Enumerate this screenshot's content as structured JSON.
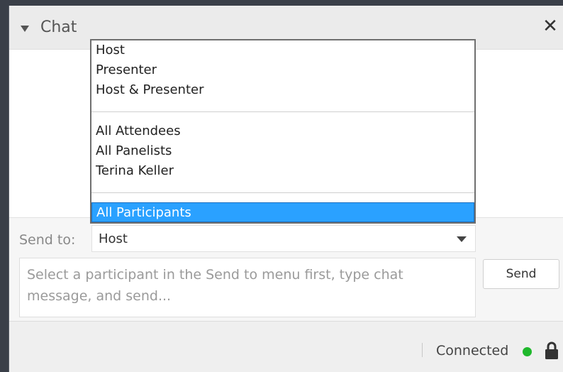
{
  "header": {
    "title": "Chat"
  },
  "dropdown": {
    "groups": [
      [
        "Host",
        "Presenter",
        "Host & Presenter"
      ],
      [
        "All Attendees",
        "All Panelists",
        "Terina Keller"
      ],
      [
        "All Participants"
      ]
    ],
    "selected": "All Participants"
  },
  "compose": {
    "sendto_label": "Send to:",
    "sendto_value": "Host",
    "message_placeholder": "Select a participant in the Send to menu first, type chat message, and send...",
    "send_label": "Send"
  },
  "status": {
    "text": "Connected",
    "color": "#1fb82c"
  },
  "icons": {
    "collapse": "triangle-down-icon",
    "close": "close-icon",
    "dropdown": "chevron-down-icon",
    "lock": "lock-icon"
  },
  "colors": {
    "selection": "#2aa1ff",
    "header_bg": "#ebebeb",
    "status_dot": "#1fb82c"
  }
}
